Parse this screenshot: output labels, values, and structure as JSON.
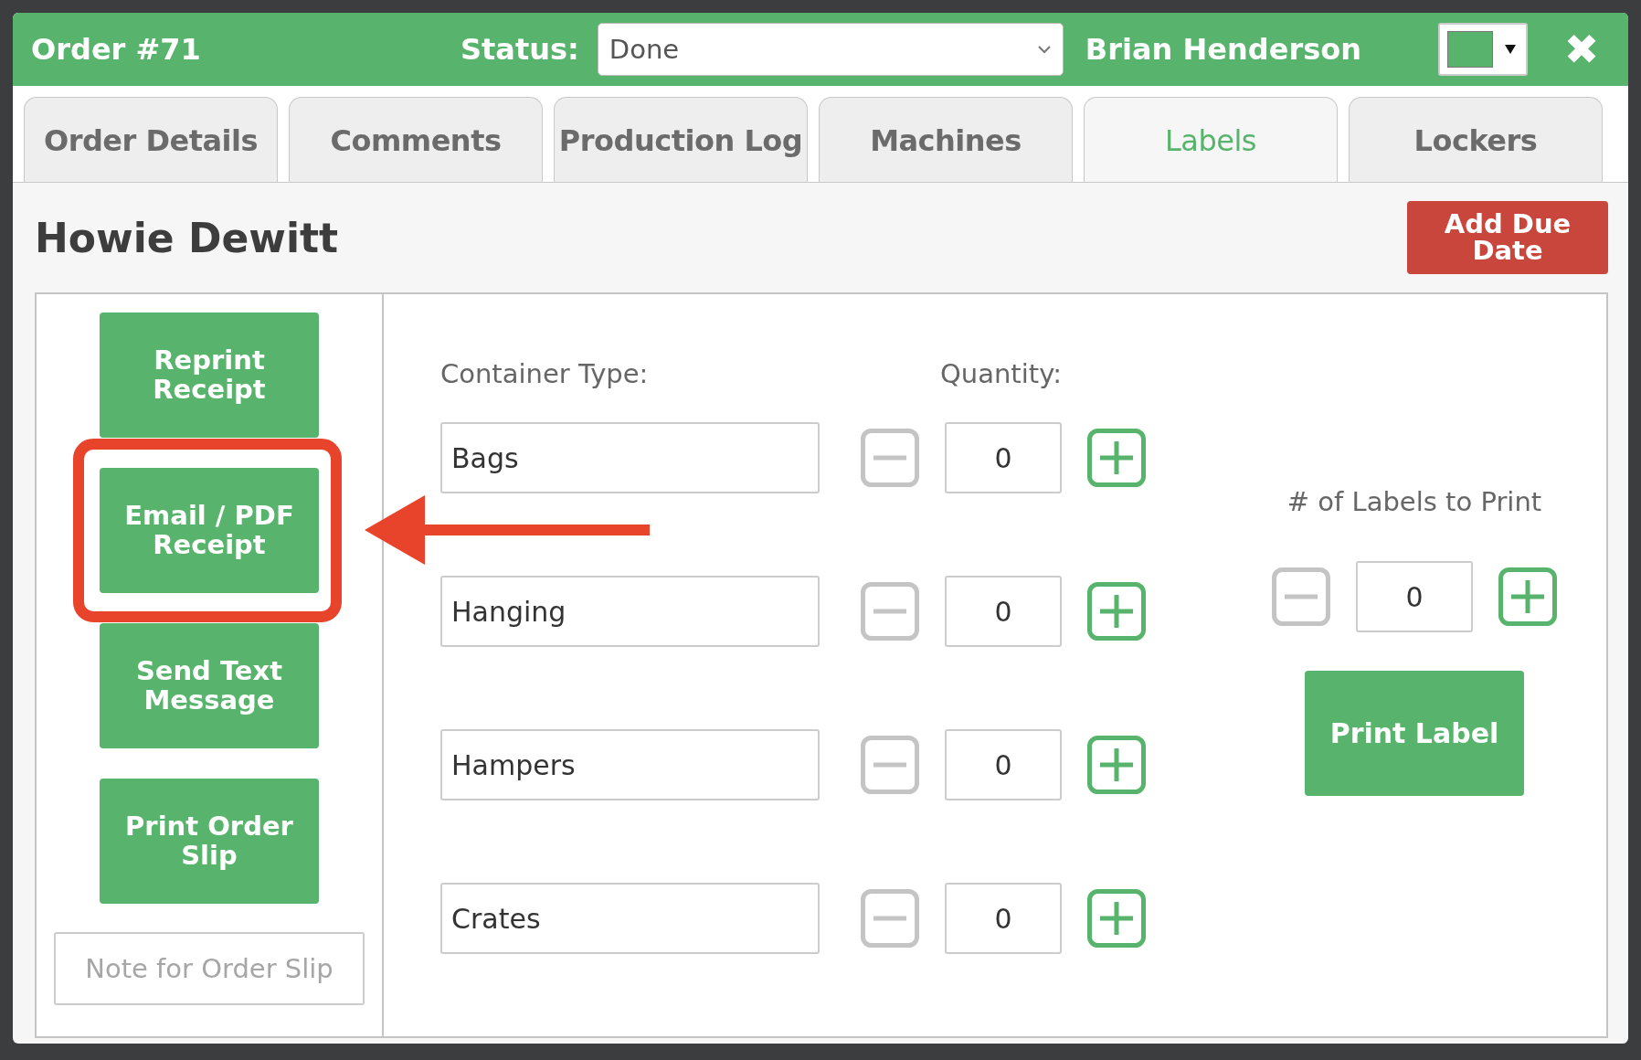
{
  "header": {
    "title": "Order #71",
    "status_label": "Status:",
    "status_value": "Done",
    "user": "Brian Henderson",
    "close": "✖"
  },
  "tabs": [
    {
      "label": "Order Details",
      "selected": false
    },
    {
      "label": "Comments",
      "selected": false
    },
    {
      "label": "Production Log",
      "selected": false
    },
    {
      "label": "Machines",
      "selected": false
    },
    {
      "label": "Labels",
      "selected": true
    },
    {
      "label": "Lockers",
      "selected": false
    }
  ],
  "customer_name": "Howie Dewitt",
  "add_due_date": "Add Due Date",
  "actions": [
    {
      "label": "Reprint Receipt",
      "highlighted": false
    },
    {
      "label": "Email / PDF Receipt",
      "highlighted": true
    },
    {
      "label": "Send Text Message",
      "highlighted": false
    },
    {
      "label": "Print Order Slip",
      "highlighted": false
    }
  ],
  "note": {
    "placeholder": "Note for Order Slip"
  },
  "container_type_label": "Container Type:",
  "quantity_label": "Quantity:",
  "containers": [
    {
      "name": "Bags",
      "quantity": "0"
    },
    {
      "name": "Hanging",
      "quantity": "0"
    },
    {
      "name": "Hampers",
      "quantity": "0"
    },
    {
      "name": "Crates",
      "quantity": "0"
    }
  ],
  "labels_to_print": {
    "label": "# of Labels to Print",
    "quantity": "0"
  },
  "print_label": "Print Label"
}
